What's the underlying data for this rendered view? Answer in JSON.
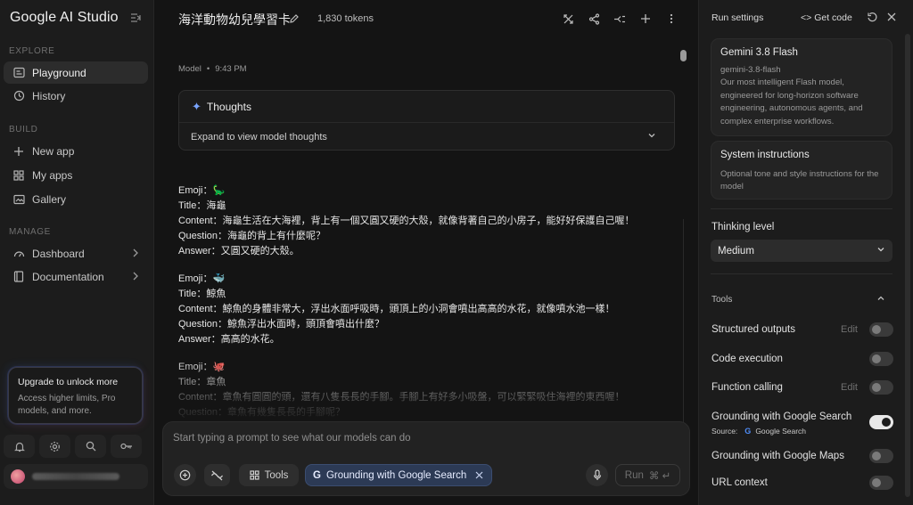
{
  "sidebar": {
    "brand": "Google AI Studio",
    "sections": {
      "explore": "EXPLORE",
      "build": "BUILD",
      "manage": "MANAGE"
    },
    "items": [
      {
        "label": "Playground",
        "icon": "playground-icon"
      },
      {
        "label": "History",
        "icon": "history-icon"
      },
      {
        "label": "New app",
        "icon": "plus-icon"
      },
      {
        "label": "My apps",
        "icon": "apps-grid-icon"
      },
      {
        "label": "Gallery",
        "icon": "gallery-icon"
      },
      {
        "label": "Dashboard",
        "icon": "dashboard-icon"
      },
      {
        "label": "Documentation",
        "icon": "book-icon"
      }
    ],
    "upgrade": {
      "title": "Upgrade to unlock more",
      "description": "Access higher limits, Pro models, and more."
    },
    "bottom_icons": [
      "bell-icon",
      "gear-icon",
      "search-icon",
      "key-icon"
    ]
  },
  "main": {
    "title": "海洋動物幼兒學習卡",
    "tokens": "1,830 tokens",
    "meta": {
      "role": "Model",
      "time": "9:43 PM"
    },
    "thoughts": {
      "label": "Thoughts",
      "expand": "Expand to view model thoughts"
    },
    "cards": [
      {
        "emoji": "Emoji：🦕",
        "title": "Title：海龜",
        "content": "Content：海龜生活在大海裡，背上有一個又圓又硬的大殼，就像背著自己的小房子，能好好保護自己喔！",
        "question": "Question：海龜的背上有什麼呢？",
        "answer": "Answer：又圓又硬的大殼。"
      },
      {
        "emoji": "Emoji：🐳",
        "title": "Title：鯨魚",
        "content": "Content：鯨魚的身體非常大，浮出水面呼吸時，頭頂上的小洞會噴出高高的水花，就像噴水池一樣！",
        "question": "Question：鯨魚浮出水面時，頭頂會噴出什麼？",
        "answer": "Answer：高高的水花。"
      },
      {
        "emoji": "Emoji：🐙",
        "title": "Title：章魚",
        "content": "Content：章魚有圓圓的頭，還有八隻長長的手腳。手腳上有好多小吸盤，可以緊緊吸住海裡的東西喔！",
        "question": "Question：章魚有幾隻長長的手腳呢？",
        "answer": ""
      }
    ],
    "composer": {
      "placeholder": "Start typing a prompt to see what our models can do",
      "tools_label": "Tools",
      "grounding_chip": "Grounding with Google Search",
      "run_label": "Run",
      "run_shortcut": "⌘ ↵"
    }
  },
  "panel": {
    "title": "Run settings",
    "get_code": "Get code",
    "model": {
      "name": "Gemini 3.8 Flash",
      "id": "gemini-3.8-flash",
      "description": "Our most intelligent Flash model, engineered for long-horizon software engineering, autonomous agents, and complex enterprise workflows."
    },
    "system_instructions": {
      "title": "System instructions",
      "placeholder": "Optional tone and style instructions for the model"
    },
    "thinking": {
      "label": "Thinking level",
      "value": "Medium"
    },
    "tools_header": "Tools",
    "tools": [
      {
        "label": "Structured outputs",
        "edit": "Edit",
        "on": false
      },
      {
        "label": "Code execution",
        "edit": "",
        "on": false
      },
      {
        "label": "Function calling",
        "edit": "Edit",
        "on": false
      },
      {
        "label": "Grounding with Google Search",
        "edit": "",
        "on": true
      },
      {
        "label": "Grounding with Google Maps",
        "edit": "",
        "on": false
      },
      {
        "label": "URL context",
        "edit": "",
        "on": false
      }
    ],
    "source_label": "Source:",
    "source_value": "Google Search"
  }
}
